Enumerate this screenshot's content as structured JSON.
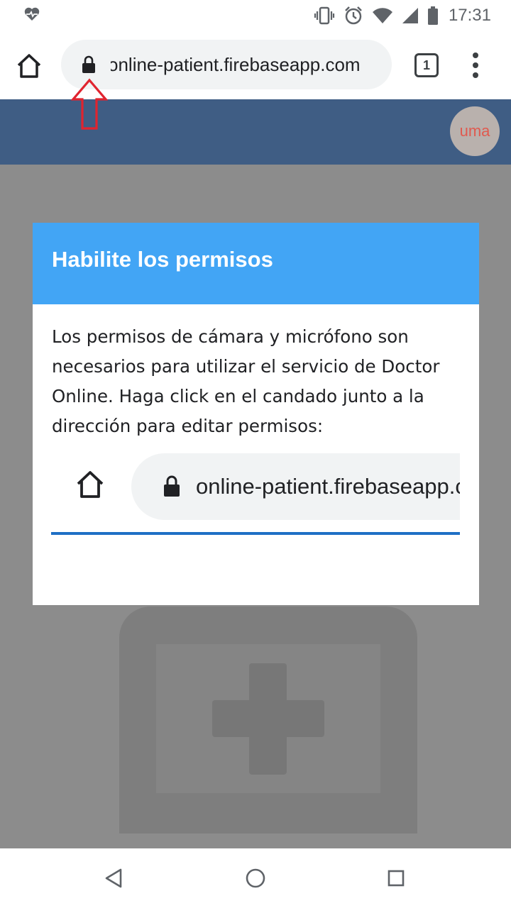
{
  "status_bar": {
    "time": "17:31",
    "icons": [
      "heart-pulse-icon",
      "vibrate-icon",
      "alarm-icon",
      "wifi-icon",
      "cell-signal-icon",
      "battery-icon"
    ]
  },
  "browser": {
    "url": "online-patient.firebaseapp.com",
    "tab_count": "1"
  },
  "app": {
    "avatar_text": "uma",
    "colors": {
      "header": "#3f5d84",
      "accent": "#42a5f5",
      "underline": "#1e6fc5",
      "annotation": "#e0242f"
    }
  },
  "dialog": {
    "title": "Habilite los permisos",
    "body": "Los permisos de cámara y micrófono son necesarios para utilizar el servicio de Doctor Online. Haga click en el candado junto a la dirección para editar permisos:",
    "illustration_url": "online-patient.firebaseapp.com"
  }
}
